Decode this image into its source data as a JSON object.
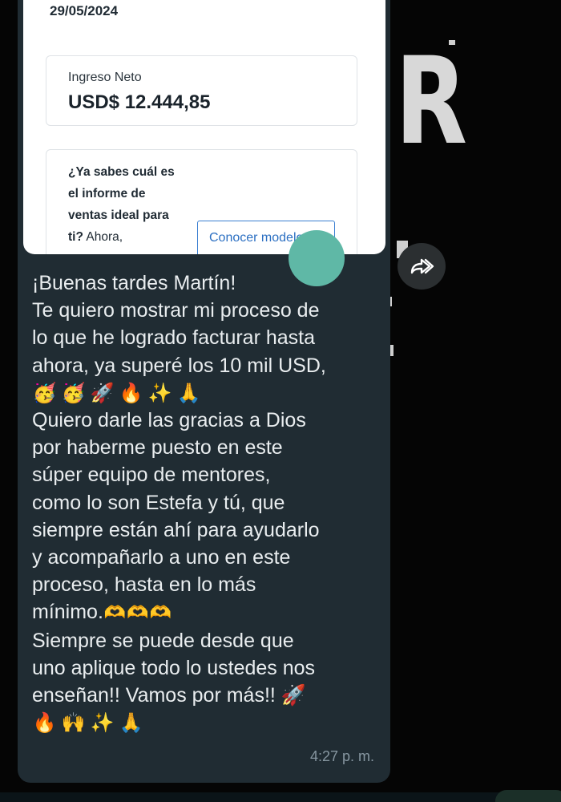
{
  "card": {
    "date": "29/05/2024",
    "net_income_label": "Ingreso Neto",
    "net_income_value": "USD$ 12.444,85",
    "info_bold": "¿Ya sabes cuál es el informe de ventas ideal para ti?",
    "info_rest": " Ahora,",
    "info_lines": [
      "¿Ya sabes cuál es",
      "el informe de",
      "ventas ideal para",
      "ti?"
    ],
    "button_label": "Conocer modelos"
  },
  "message": {
    "lines": [
      "¡Buenas tardes Martín!",
      "Te quiero mostrar mi proceso de",
      "lo que he logrado facturar hasta",
      "ahora, ya superé los 10 mil USD,"
    ],
    "emoji_row_1": [
      "🥳",
      "🥳",
      "🚀",
      "🔥",
      "✨",
      "🙏"
    ],
    "lines_2": [
      "Quiero darle las gracias a Dios",
      "por haberme puesto en este",
      "súper equipo de mentores,",
      "como lo son Estefa y tú, que",
      "siempre están ahí para ayudarlo",
      "y acompañarlo a uno en este",
      "proceso, hasta en lo más"
    ],
    "line_min": "mínimo.",
    "hearts": [
      "🫶",
      "🫶",
      "🫶"
    ],
    "lines_3": [
      "Siempre se puede desde que",
      "uno aplique todo lo ustedes nos"
    ],
    "line_last": "enseñan!! Vamos por más!!",
    "line_last_emoji": "🚀",
    "emoji_row_2": [
      "🔥",
      "🙌",
      "✨",
      "🙏"
    ],
    "time": "4:27 p. m."
  },
  "background": {
    "letter": "R"
  },
  "icons": {
    "forward": "forward-icon"
  },
  "colors": {
    "bubble": "#202c33",
    "accent_teal": "#5fb8a6",
    "link_blue": "#2b6fc2"
  }
}
